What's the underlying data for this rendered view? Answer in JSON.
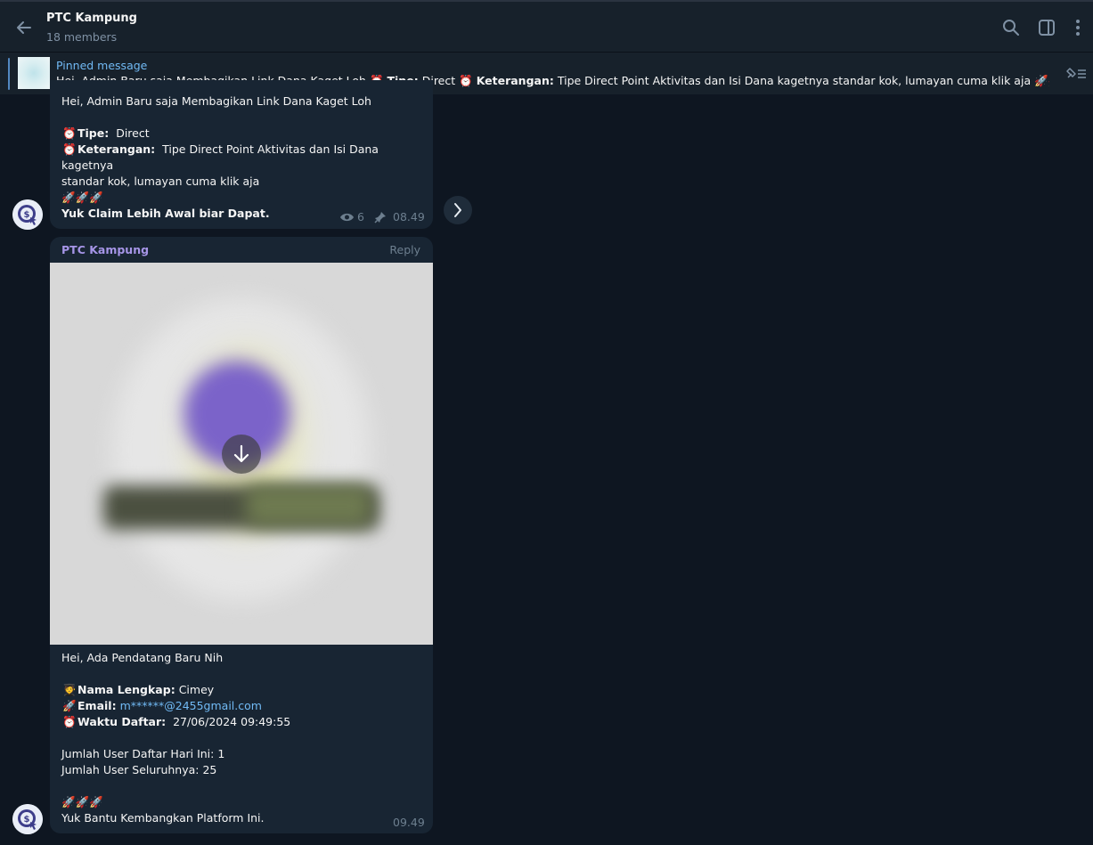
{
  "header": {
    "title": "PTC Kampung",
    "subtitle": "18 members"
  },
  "pinned": {
    "label": "Pinned message",
    "text_pre": "Hei, Admin Baru saja Membagikan Link Dana Kaget Loh ",
    "tipe_label": "Tipe:",
    "tipe_value": " Direct ",
    "ket_label": "Keterangan:",
    "ket_value": " Tipe Direct Point Aktivitas dan Isi Dana kagetnya standar kok, lumayan cuma klik aja ",
    "ellipsis": "…"
  },
  "message1": {
    "line1": "Hei, Admin Baru saja Membagikan Link Dana Kaget Loh",
    "tipe_label": "Tipe:",
    "tipe_value": "Direct",
    "ket_label": "Keterangan:",
    "ket_value": "Tipe Direct Point Aktivitas dan Isi Dana kagetnya",
    "ket_value2": "standar kok, lumayan cuma klik aja",
    "cta": "Yuk Claim Lebih Awal biar Dapat.",
    "views": "6",
    "time": "08.49"
  },
  "message2": {
    "sender": "PTC Kampung",
    "reply_label": "Reply",
    "line1": "Hei, Ada Pendatang Baru Nih",
    "name_label": "Nama Lengkap:",
    "name_value": "Cimey",
    "email_label": "Email:",
    "email_value": "m******@2455gmail.com",
    "time_label": "Waktu Daftar:",
    "time_value": "27/06/2024 09:49:55",
    "today_count": "Jumlah User Daftar Hari Ini: 1",
    "total_count": "Jumlah User Seluruhnya: 25",
    "cta": "Yuk Bantu Kembangkan Platform Ini.",
    "time": "09.49"
  },
  "colors": {
    "background": "#0e1621",
    "panel": "#17212b",
    "bubble": "#182533",
    "accent": "#71baf5",
    "sender": "#a695e7"
  },
  "icons": [
    "back-arrow-icon",
    "search-icon",
    "sidebar-toggle-icon",
    "more-vert-icon",
    "unpin-icon",
    "eye-icon",
    "pin-icon",
    "chevron-right-icon",
    "download-icon",
    "alarm-clock-icon",
    "rocket-icon",
    "student-icon"
  ]
}
